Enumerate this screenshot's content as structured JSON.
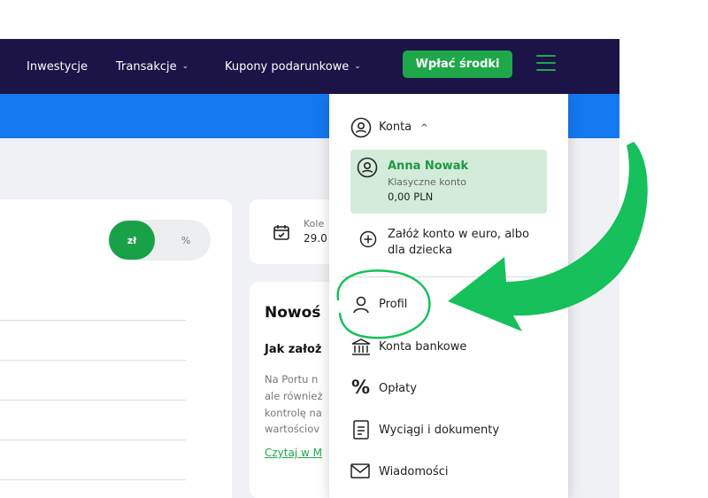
{
  "nav": {
    "items": [
      {
        "label": "Inwestycje",
        "has_chevron": false
      },
      {
        "label": "Transakcje",
        "has_chevron": true
      },
      {
        "label": "Kupony podarunkowe",
        "has_chevron": true
      }
    ],
    "deposit_label": "Wpłać środki",
    "menu_icon": "hamburger-icon"
  },
  "toggle": {
    "active": "zł",
    "inactive": "%"
  },
  "date_card": {
    "label": "Kole",
    "value": "29.0",
    "icon": "calendar-icon"
  },
  "news": {
    "title": "Nowoś",
    "subtitle": "Jak założ",
    "lines": [
      "Na Portu n",
      "ale również",
      "kontrolę na",
      "wartościov"
    ],
    "link": "Czytaj w M"
  },
  "dropdown": {
    "accounts_label": "Konta",
    "user": {
      "name": "Anna Nowak",
      "account_type": "Klasyczne konto",
      "balance": "0,00 PLN"
    },
    "create_account_line1": "Załóż konto w euro, albo",
    "create_account_line2": "dla dziecka",
    "items": [
      {
        "label": "Profil",
        "icon": "person-icon"
      },
      {
        "label": "Konta bankowe",
        "icon": "bank-icon"
      },
      {
        "label": "Opłaty",
        "icon": "percent-icon"
      },
      {
        "label": "Wyciągi i dokumenty",
        "icon": "document-icon"
      },
      {
        "label": "Wiadomości",
        "icon": "envelope-icon"
      }
    ]
  },
  "colors": {
    "nav_bg": "#1c1446",
    "accent_green": "#1fa84a",
    "blue_bar": "#1478f0",
    "user_card_bg": "#d3ecd9"
  }
}
